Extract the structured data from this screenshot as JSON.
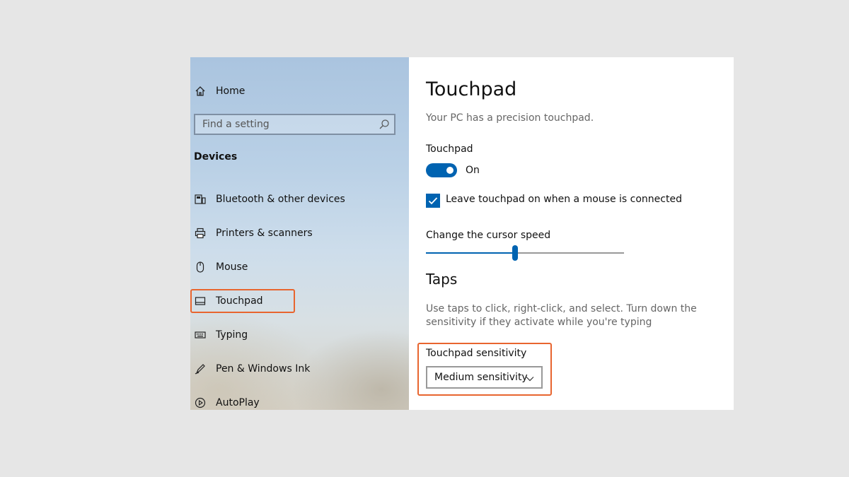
{
  "sidebar": {
    "home_label": "Home",
    "search_placeholder": "Find a setting",
    "section_title": "Devices",
    "items": [
      {
        "label": "Bluetooth & other devices",
        "icon": "bluetooth-devices-icon"
      },
      {
        "label": "Printers & scanners",
        "icon": "printer-icon"
      },
      {
        "label": "Mouse",
        "icon": "mouse-icon"
      },
      {
        "label": "Touchpad",
        "icon": "touchpad-icon",
        "selected": true
      },
      {
        "label": "Typing",
        "icon": "keyboard-icon"
      },
      {
        "label": "Pen & Windows Ink",
        "icon": "pen-icon"
      },
      {
        "label": "AutoPlay",
        "icon": "autoplay-icon"
      }
    ]
  },
  "main": {
    "title": "Touchpad",
    "subtitle": "Your PC has a precision touchpad.",
    "touchpad_toggle": {
      "label": "Touchpad",
      "state_label": "On",
      "on": true
    },
    "leave_on_checkbox": {
      "label": "Leave touchpad on when a mouse is connected",
      "checked": true
    },
    "cursor_speed": {
      "label": "Change the cursor speed",
      "value_fraction": 0.45
    },
    "taps": {
      "heading": "Taps",
      "description": "Use taps to click, right-click, and select. Turn down the sensitivity if they activate while you're typing",
      "sensitivity_label": "Touchpad sensitivity",
      "sensitivity_value": "Medium sensitivity"
    }
  },
  "colors": {
    "accent": "#0063b1",
    "highlight_border": "#e8652f"
  }
}
